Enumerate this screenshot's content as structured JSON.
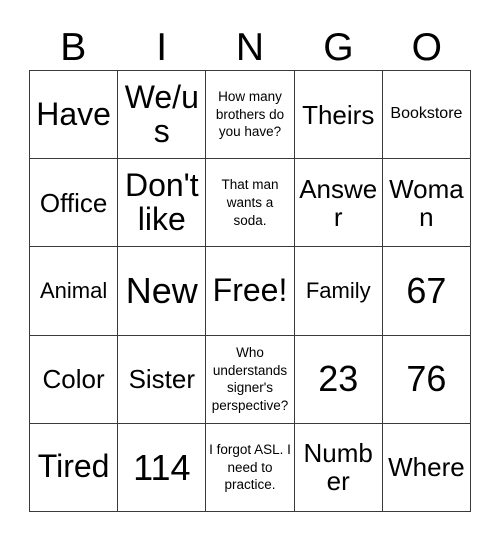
{
  "card": {
    "header_letters": [
      "B",
      "I",
      "N",
      "G",
      "O"
    ],
    "rows": [
      [
        {
          "text": "Have",
          "size": "lg"
        },
        {
          "text": "We/us",
          "size": "lg"
        },
        {
          "text": "How many brothers do you have?",
          "size": "xxs"
        },
        {
          "text": "Theirs",
          "size": "md"
        },
        {
          "text": "Bookstore",
          "size": "xs"
        }
      ],
      [
        {
          "text": "Office",
          "size": "md"
        },
        {
          "text": "Don't like",
          "size": "lg"
        },
        {
          "text": "That man wants a soda.",
          "size": "xxs"
        },
        {
          "text": "Answer",
          "size": "md"
        },
        {
          "text": "Woman",
          "size": "md"
        }
      ],
      [
        {
          "text": "Animal",
          "size": "sm"
        },
        {
          "text": "New",
          "size": "xl"
        },
        {
          "text": "Free!",
          "size": "lg"
        },
        {
          "text": "Family",
          "size": "sm"
        },
        {
          "text": "67",
          "size": "xl"
        }
      ],
      [
        {
          "text": "Color",
          "size": "md"
        },
        {
          "text": "Sister",
          "size": "md"
        },
        {
          "text": "Who understands signer's perspective?",
          "size": "xxs"
        },
        {
          "text": "23",
          "size": "xl"
        },
        {
          "text": "76",
          "size": "xl"
        }
      ],
      [
        {
          "text": "Tired",
          "size": "lg"
        },
        {
          "text": "114",
          "size": "xl"
        },
        {
          "text": "I forgot ASL. I need to practice.",
          "size": "xxs"
        },
        {
          "text": "Number",
          "size": "md"
        },
        {
          "text": "Where",
          "size": "md"
        }
      ]
    ]
  }
}
